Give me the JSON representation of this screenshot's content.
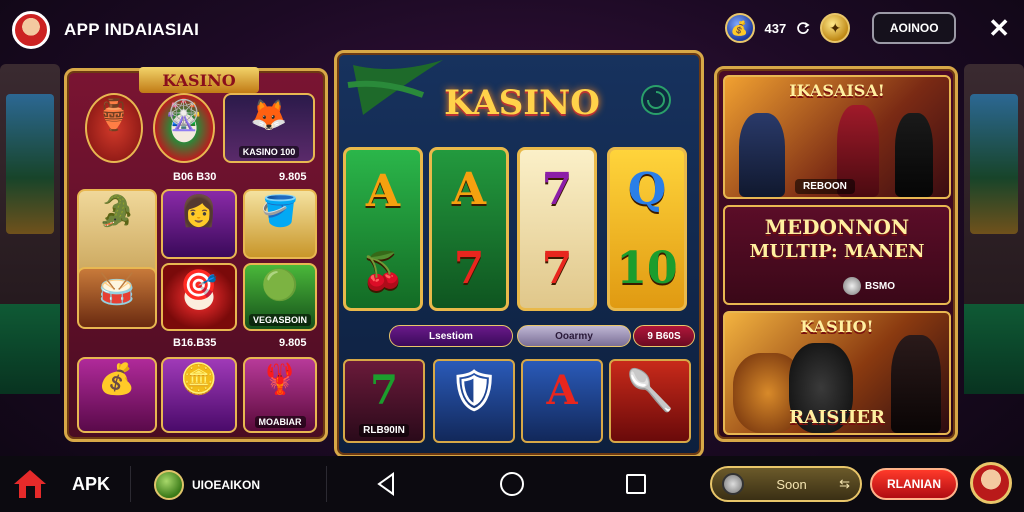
{
  "header": {
    "app_title": "APP INDAIASIAI",
    "balance": "437",
    "account_button": "AOINOO",
    "close_glyph": "✕"
  },
  "left_panel": {
    "ribbon": "KASINO",
    "tiles": [
      {
        "label": "",
        "glyph": "🏺"
      },
      {
        "label": "",
        "glyph": "🎡"
      },
      {
        "label": "KASINO 100",
        "glyph": "🦊"
      },
      {
        "label": "",
        "glyph": "🐊"
      },
      {
        "label": "",
        "glyph": "👩"
      },
      {
        "label": "",
        "glyph": "🪣"
      },
      {
        "label": "",
        "glyph": "🥁"
      },
      {
        "label": "",
        "glyph": "🎯"
      },
      {
        "label": "VEGASBOIN",
        "glyph": "🟢"
      },
      {
        "label": "",
        "glyph": "💰"
      },
      {
        "label": "",
        "glyph": "🪙"
      },
      {
        "label": "MOABIAR",
        "glyph": "🦞"
      }
    ],
    "captions": [
      "B06 B30",
      "9.805",
      "B16.B35",
      "9.805"
    ]
  },
  "center_panel": {
    "title": "KASINO",
    "reels": [
      {
        "top": "A",
        "bottom": "🍒"
      },
      {
        "top": "A",
        "bottom": "7"
      },
      {
        "top": "7",
        "bottom": "7"
      },
      {
        "top": "Q",
        "bottom": "10"
      }
    ],
    "pills": [
      "Lsestiom",
      "Ooarmy",
      "9 B60S"
    ],
    "games": [
      {
        "label": "RLB90IN",
        "glyph": "7"
      },
      {
        "label": "",
        "glyph": "🛡"
      },
      {
        "label": "",
        "glyph": "A"
      },
      {
        "label": "",
        "glyph": "🥄"
      }
    ]
  },
  "right_panel": {
    "promo1_title": "IKASAISA!",
    "promo1_caption": "REBOON",
    "promo2_title_line1": "MEDONNON",
    "promo2_title_line2": "MULTIP: MANEN",
    "promo2_chip": "BSMO",
    "promo3_title": "KASIIO!",
    "promo3_caption": "RAISIIER"
  },
  "bottom": {
    "apk_label": "APK",
    "promo_user": "UIOEAIKON",
    "soon_button": "Soon",
    "main_button": "RLANIAN"
  },
  "colors": {
    "accent_gold": "#d7a847",
    "cta_red": "#e0201a",
    "panel_left": "#7a1432",
    "panel_center": "#17325e"
  }
}
